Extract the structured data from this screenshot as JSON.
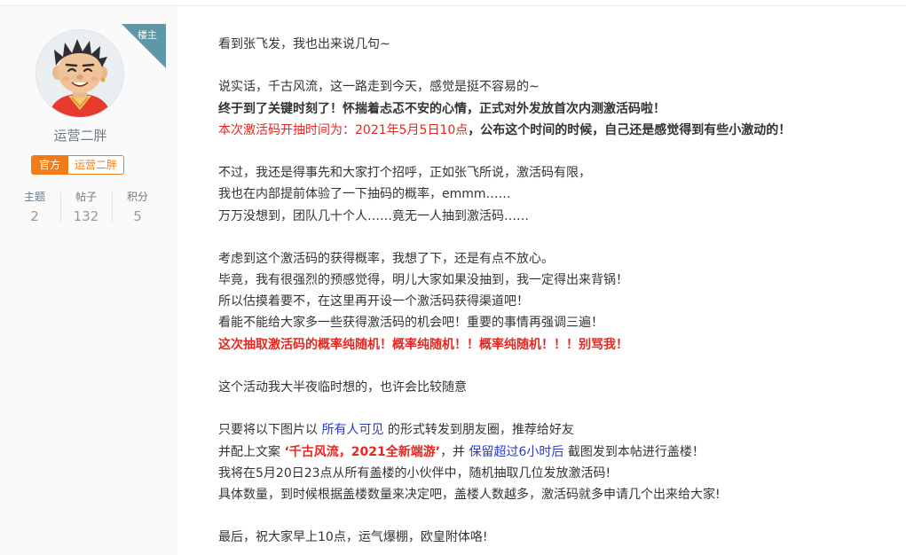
{
  "author": {
    "op_badge": "楼主",
    "name": "运营二胖",
    "badge_official": "官方",
    "badge_name": "运营二胖",
    "stats": [
      {
        "label": "主题",
        "value": "2"
      },
      {
        "label": "帖子",
        "value": "132"
      },
      {
        "label": "积分",
        "value": "5"
      }
    ]
  },
  "post": {
    "l1": "看到张飞发，我也出来说几句~",
    "l2": "说实话，千古风流，这一路走到今天，感觉是挺不容易的~",
    "l3": "终于到了关键时刻了！怀揣着忐忑不安的心情，正式对外发放首次内测激活码啦！",
    "l4_red": "本次激活码开抽时间为：2021年5月5日10点",
    "l4_rest": "，公布这个时间的时候，自己还是感觉得到有些小激动的！",
    "l5": "不过，我还是得事先和大家打个招呼，正如张飞所说，激活码有限，",
    "l6": "我也在内部提前体验了一下抽码的概率，emmm……",
    "l7": "万万没想到，团队几十个人……竟无一人抽到激活码……",
    "l8": "考虑到这个激活码的获得概率，我想了下，还是有点不放心。",
    "l9": "毕竟，我有很强烈的预感觉得，明儿大家如果没抽到，我一定得出来背锅！",
    "l10": "所以估摸着要不，在这里再开设一个激活码获得渠道吧！",
    "l11": "看能不能给大家多一些获得激活码的机会吧！重要的事情再强调三遍！",
    "l12": "这次抽取激活码的概率纯随机！概率纯随机！！概率纯随机！！！别骂我！",
    "l13": "这个活动我大半夜临时想的，也许会比较随意",
    "l14_a": "只要将以下图片以 ",
    "l14_b": "所有人可见",
    "l14_c": " 的形式转发到朋友圈，推荐给好友",
    "l15_a": "并配上文案 ",
    "l15_b": "‘千古风流，2021全新端游’",
    "l15_c": "，并 ",
    "l15_d": "保留超过6小时后",
    "l15_e": " 截图发到本帖进行盖楼！",
    "l16": "我将在5月20日23点从所有盖楼的小伙伴中，随机抽取几位发放激活码!",
    "l17": "具体数量，到时候根据盖楼数量来决定吧，盖楼人数越多，激活码就多申请几个出来给大家!",
    "l18": "最后，祝大家早上10点，运气爆棚，欧皇附体咯!"
  },
  "colors": {
    "accent_orange": "#f07c1a",
    "op_ribbon": "#5f97a6",
    "highlight_red": "#e8261f",
    "link_blue": "#2b3ac5"
  }
}
